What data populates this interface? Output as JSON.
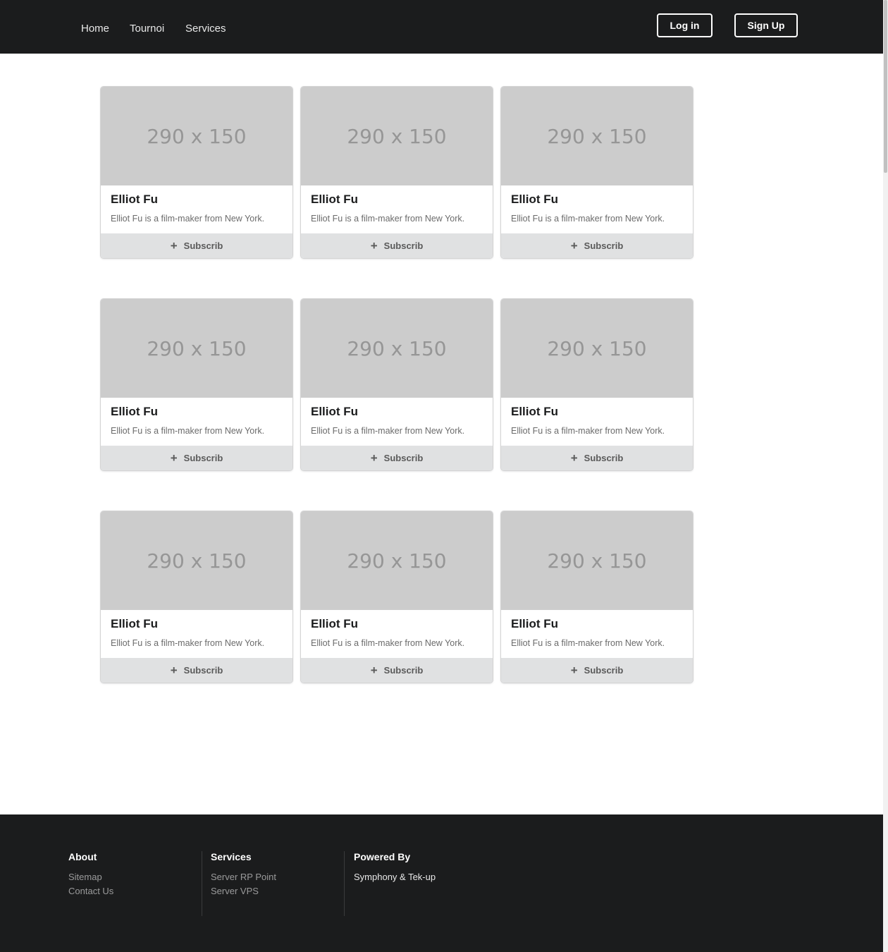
{
  "nav": {
    "links": [
      "Home",
      "Tournoi",
      "Services"
    ],
    "login_label": "Log in",
    "signup_label": "Sign Up"
  },
  "cards": [
    {
      "image_text": "290 x 150",
      "title": "Elliot Fu",
      "description": "Elliot Fu is a film-maker from New York.",
      "button_label": "Subscrib"
    },
    {
      "image_text": "290 x 150",
      "title": "Elliot Fu",
      "description": "Elliot Fu is a film-maker from New York.",
      "button_label": "Subscrib"
    },
    {
      "image_text": "290 x 150",
      "title": "Elliot Fu",
      "description": "Elliot Fu is a film-maker from New York.",
      "button_label": "Subscrib"
    },
    {
      "image_text": "290 x 150",
      "title": "Elliot Fu",
      "description": "Elliot Fu is a film-maker from New York.",
      "button_label": "Subscrib"
    },
    {
      "image_text": "290 x 150",
      "title": "Elliot Fu",
      "description": "Elliot Fu is a film-maker from New York.",
      "button_label": "Subscrib"
    },
    {
      "image_text": "290 x 150",
      "title": "Elliot Fu",
      "description": "Elliot Fu is a film-maker from New York.",
      "button_label": "Subscrib"
    },
    {
      "image_text": "290 x 150",
      "title": "Elliot Fu",
      "description": "Elliot Fu is a film-maker from New York.",
      "button_label": "Subscrib"
    },
    {
      "image_text": "290 x 150",
      "title": "Elliot Fu",
      "description": "Elliot Fu is a film-maker from New York.",
      "button_label": "Subscrib"
    },
    {
      "image_text": "290 x 150",
      "title": "Elliot Fu",
      "description": "Elliot Fu is a film-maker from New York.",
      "button_label": "Subscrib"
    }
  ],
  "footer": {
    "about": {
      "heading": "About",
      "links": [
        "Sitemap",
        "Contact Us"
      ]
    },
    "services": {
      "heading": "Services",
      "links": [
        "Server RP Point",
        "Server VPS"
      ]
    },
    "powered": {
      "heading": "Powered By",
      "text": "Symphony & Tek-up"
    }
  },
  "colors": {
    "nav_bg": "#1b1c1d",
    "placeholder_bg": "#cccccc",
    "button_bg": "#e0e1e2"
  }
}
